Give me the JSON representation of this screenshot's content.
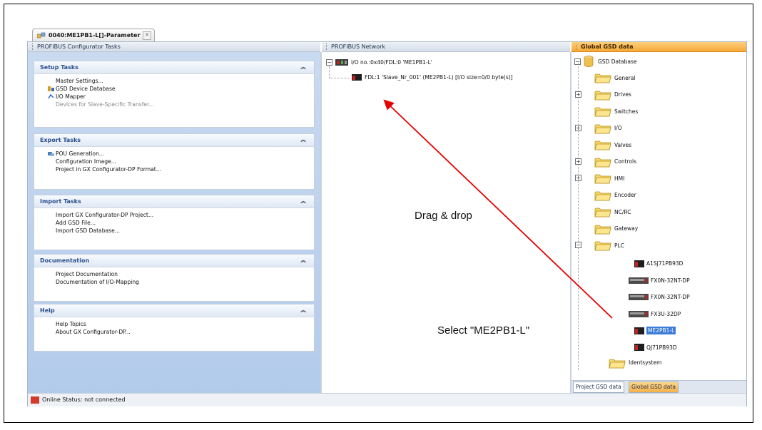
{
  "document_tab": {
    "title": "0040:ME1PB1-L[]-Parameter"
  },
  "left_panel": {
    "title": "PROFIBUS Configurator Tasks",
    "sections": [
      {
        "title": "Setup Tasks",
        "items": [
          {
            "label": "Master Settings...",
            "icon": ""
          },
          {
            "label": "GSD Device Database",
            "icon": "gsd-database-icon"
          },
          {
            "label": "I/O Mapper",
            "icon": "io-mapper-icon"
          },
          {
            "label": "Devices for Slave-Specific Transfer...",
            "icon": "",
            "disabled": true
          }
        ]
      },
      {
        "title": "Export Tasks",
        "items": [
          {
            "label": "POU Generation...",
            "icon": "pou-generation-icon"
          },
          {
            "label": "Configuration Image...",
            "icon": ""
          },
          {
            "label": "Project in GX Configurator-DP Format...",
            "icon": ""
          }
        ]
      },
      {
        "title": "Import Tasks",
        "items": [
          {
            "label": "Import GX Configurator-DP Project...",
            "icon": ""
          },
          {
            "label": "Add GSD File...",
            "icon": ""
          },
          {
            "label": "Import GSD Database...",
            "icon": ""
          }
        ]
      },
      {
        "title": "Documentation",
        "items": [
          {
            "label": "Project Documentation",
            "icon": ""
          },
          {
            "label": "Documentation of I/O-Mapping",
            "icon": ""
          }
        ]
      },
      {
        "title": "Help",
        "items": [
          {
            "label": "Help Topics",
            "icon": ""
          },
          {
            "label": "About GX Configurator-DP...",
            "icon": ""
          }
        ]
      }
    ]
  },
  "network_panel": {
    "title": "PROFIBUS Network",
    "master_node": "I/O no.:0x40/FDL:0 'ME1PB1-L'",
    "slave_node": "FDL:1 'Slave_Nr_001' (ME2PB1-L) [I/O size=0/0 byte(s)]"
  },
  "gsd_panel": {
    "title": "Global GSD data",
    "root": "GSD Database",
    "folders": [
      {
        "label": "General",
        "expander": ""
      },
      {
        "label": "Drives",
        "expander": "+"
      },
      {
        "label": "Switches",
        "expander": ""
      },
      {
        "label": "I/O",
        "expander": "+"
      },
      {
        "label": "Valves",
        "expander": ""
      },
      {
        "label": "Controls",
        "expander": "+"
      },
      {
        "label": "HMI",
        "expander": "+"
      },
      {
        "label": "Encoder",
        "expander": ""
      },
      {
        "label": "NC/RC",
        "expander": ""
      },
      {
        "label": "Gateway",
        "expander": ""
      },
      {
        "label": "PLC",
        "expander": "-"
      }
    ],
    "plc_devices": [
      "A1SJ71PB93D",
      "FX0N-32NT-DP",
      "FX0N-32NT-DP",
      "FX3U-32DP",
      "ME2PB1-L",
      "QJ71PB93D"
    ],
    "after_folder": "Identsystem",
    "tabs": [
      "Project GSD data",
      "Global GSD data"
    ]
  },
  "status_bar": {
    "text": "Online Status: not connected"
  },
  "annotations": {
    "drag": "Drag & drop",
    "select": "Select \"ME2PB1-L\""
  },
  "colors": {
    "accent": "#f5a83a",
    "arrow": "#e60000",
    "selection": "#3a7bd5"
  }
}
